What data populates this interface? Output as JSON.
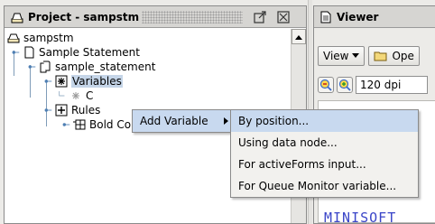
{
  "project_panel": {
    "title": "Project - sampstm",
    "tree": {
      "root": "sampstm",
      "statement": "Sample Statement",
      "document": "sample_statement",
      "variables": "Variables",
      "variable_child": "C",
      "rules": "Rules",
      "rule_child": "Bold CompanyN"
    }
  },
  "viewer_panel": {
    "title": "Viewer",
    "view_menu": "View",
    "open_button": "Ope",
    "dpi_value": "120 dpi",
    "preview_text": "MINISOFT"
  },
  "context_menu": {
    "add_variable": "Add Variable"
  },
  "submenu": {
    "items": [
      "By position...",
      "Using data node...",
      "For activeForms input...",
      "For Queue Monitor variable..."
    ]
  },
  "colors": {
    "selection": "#c5d5e8",
    "menu_highlight": "#c8d9ef",
    "preview_text": "#3a45c8"
  }
}
